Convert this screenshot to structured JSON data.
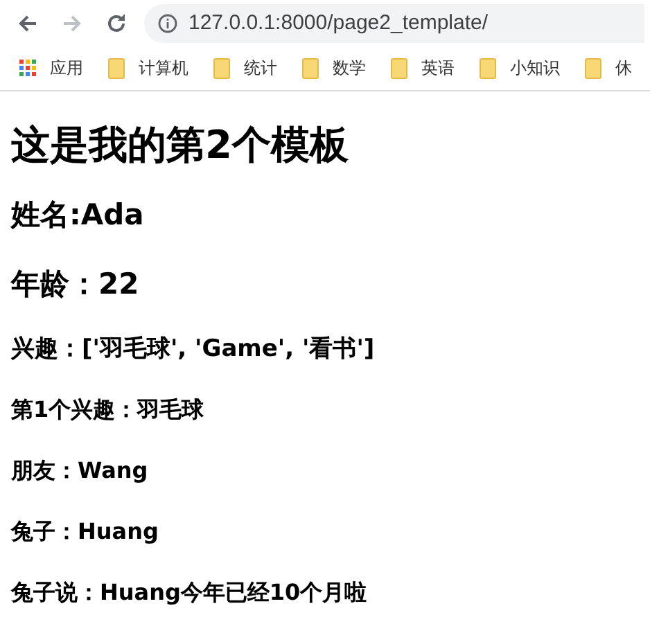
{
  "toolbar": {
    "back": {
      "disabled": false
    },
    "forward": {
      "disabled": true
    },
    "url": "127.0.0.1:8000/page2_template/"
  },
  "bookmarks": [
    {
      "kind": "apps",
      "label": "应用"
    },
    {
      "kind": "folder",
      "label": "计算机"
    },
    {
      "kind": "folder",
      "label": "统计"
    },
    {
      "kind": "folder",
      "label": "数学"
    },
    {
      "kind": "folder",
      "label": "英语"
    },
    {
      "kind": "folder",
      "label": "小知识"
    },
    {
      "kind": "folder",
      "label": "休"
    }
  ],
  "content": [
    {
      "kind": "h1",
      "text": "这是我的第2个模板"
    },
    {
      "kind": "h2",
      "text": "姓名:Ada"
    },
    {
      "kind": "h2",
      "text": "年龄：22"
    },
    {
      "kind": "h3",
      "text": "兴趣：['羽毛球', 'Game', '看书']"
    },
    {
      "kind": "h4",
      "text": "第1个兴趣：羽毛球"
    },
    {
      "kind": "h4",
      "text": "朋友：Wang"
    },
    {
      "kind": "h4",
      "text": "兔子：Huang"
    },
    {
      "kind": "h4",
      "text": "兔子说：Huang今年已经10个月啦"
    }
  ]
}
